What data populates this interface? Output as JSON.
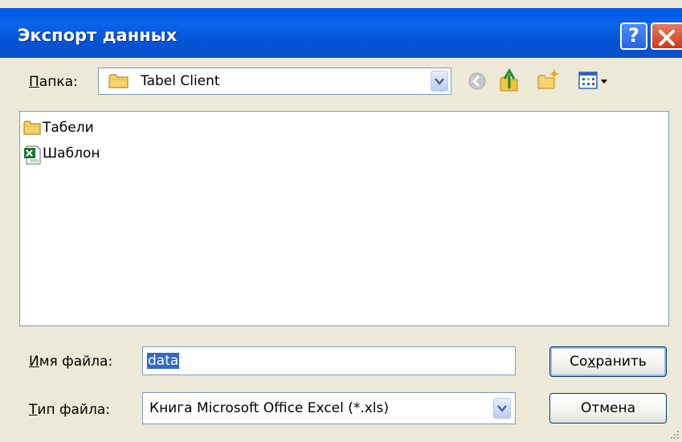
{
  "window": {
    "title": "Экспорт данных",
    "help_glyph": "?",
    "close_icon": "close-icon",
    "title_bar_color": "#0553d5"
  },
  "toolbar": {
    "folder_label_accel": "П",
    "folder_label_rest": "апка:",
    "current_folder": "Tabel Client",
    "icons": [
      "back-icon",
      "up-folder-icon",
      "new-folder-icon",
      "view-menu-icon"
    ]
  },
  "files": [
    {
      "name": "Табели",
      "icon": "folder-icon"
    },
    {
      "name": "Шаблон",
      "icon": "excel-file-icon"
    }
  ],
  "filename": {
    "label_accel": "И",
    "label_rest": "мя файла:",
    "value": "data"
  },
  "filetype": {
    "label_accel": "Т",
    "label_rest": "ип файла:",
    "value": "Книга Microsoft Office Excel (*.xls)"
  },
  "buttons": {
    "save_pre": "Со",
    "save_accel": "х",
    "save_post": "ранить",
    "cancel": "Отмена"
  }
}
